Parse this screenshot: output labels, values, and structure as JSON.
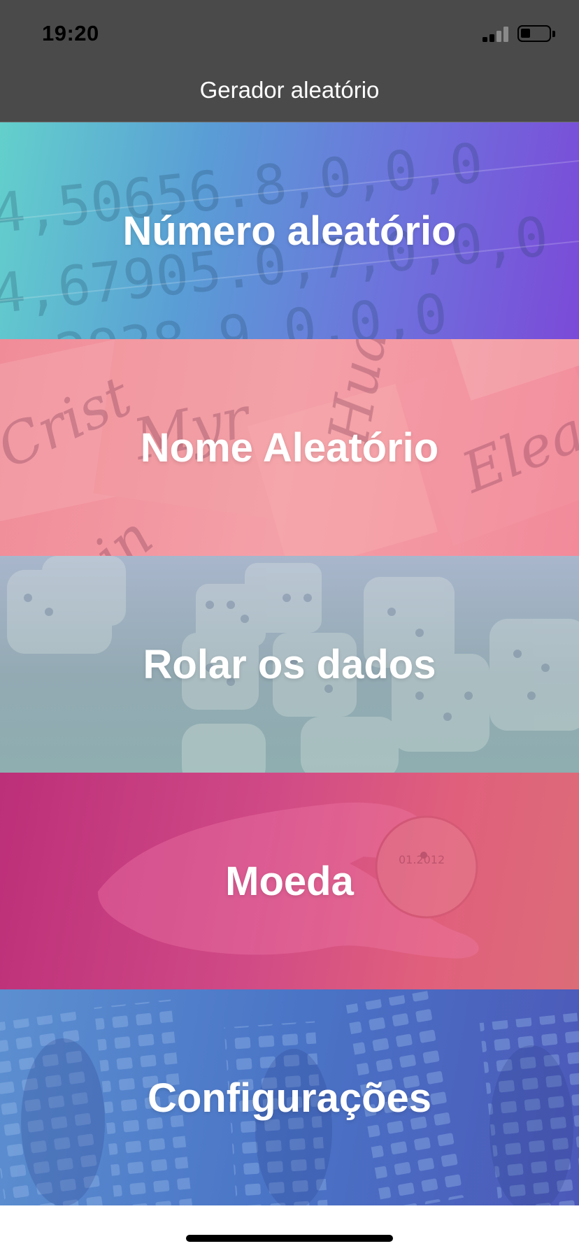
{
  "status_bar": {
    "time": "19:20",
    "signal_icon": "cellular-signal-icon",
    "battery_icon": "battery-icon",
    "battery_level": 0.35
  },
  "nav": {
    "title": "Gerador aleatório"
  },
  "menu": {
    "items": [
      {
        "label": "Número aleatório",
        "background": "digits-photo"
      },
      {
        "label": "Nome Aleatório",
        "background": "name-cards-photo"
      },
      {
        "label": "Rolar os dados",
        "background": "dice-photo"
      },
      {
        "label": "Moeda",
        "background": "coin-photo"
      },
      {
        "label": "Configurações",
        "background": "gears-photo"
      }
    ]
  },
  "colors": {
    "topbar": "#4a4a4a",
    "random_number": "#6f6fdc",
    "random_name": "#f4a0a8",
    "dice": "#93aab3",
    "coin": "#d04a86",
    "settings": "#4a74c6"
  }
}
